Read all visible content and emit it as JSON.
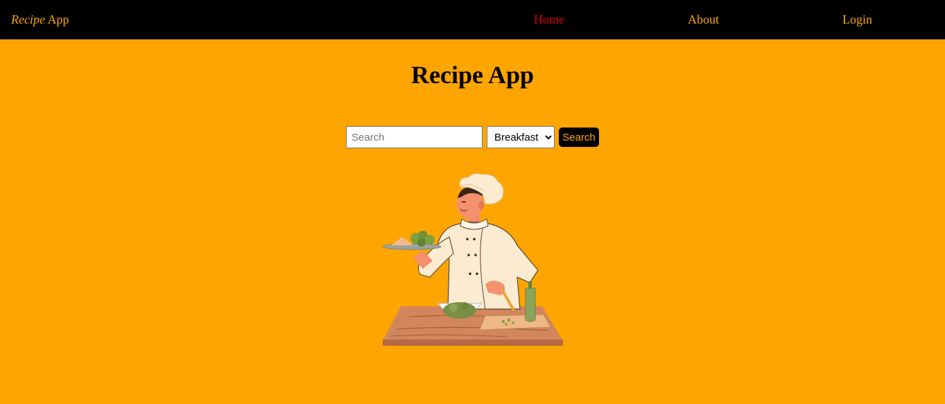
{
  "navbar": {
    "brand_italic": "Recipe",
    "brand_rest": " App",
    "links": [
      {
        "label": "Home",
        "active": true
      },
      {
        "label": "About",
        "active": false
      },
      {
        "label": "Login",
        "active": false
      }
    ]
  },
  "main": {
    "title": "Recipe App",
    "search": {
      "placeholder": "Search",
      "value": "",
      "meal_selected": "Breakfast",
      "button_label": "Search"
    },
    "illustration": "chef-cooking-illustration"
  },
  "colors": {
    "background": "#FFA500",
    "navbar": "#000000",
    "accent": "#FFA500",
    "active_link": "#E00000",
    "button_bg": "#000000",
    "button_text": "#FFA500"
  }
}
